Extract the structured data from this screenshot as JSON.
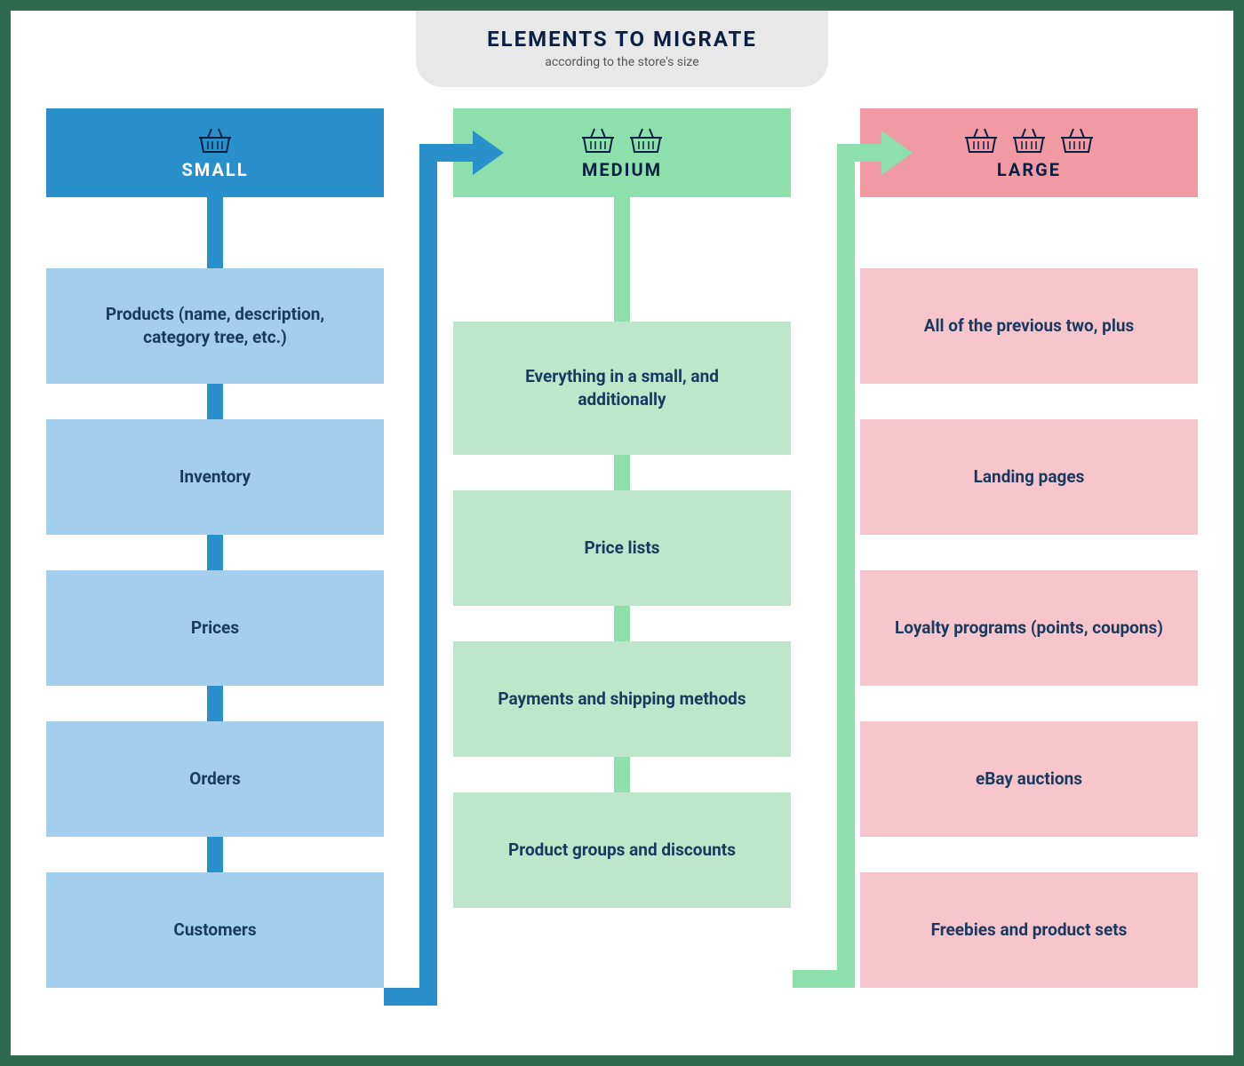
{
  "title": "ELEMENTS TO MIGRATE",
  "subtitle": "according to the store's size",
  "columns": {
    "small": {
      "label": "SMALL",
      "baskets": 1,
      "items": [
        "Products (name, description, category tree, etc.)",
        "Inventory",
        "Prices",
        "Orders",
        "Customers"
      ]
    },
    "medium": {
      "label": "MEDIUM",
      "baskets": 2,
      "items": [
        "Everything in a small, and additionally",
        "Price lists",
        "Payments and shipping methods",
        "Product groups and discounts"
      ]
    },
    "large": {
      "label": "LARGE",
      "baskets": 3,
      "items": [
        "All of the previous two, plus",
        "Landing pages",
        "Loyalty programs (points, coupons)",
        "eBay auctions",
        "Freebies and product sets"
      ]
    }
  },
  "colors": {
    "small_header": "#2990cc",
    "small_item": "#a3cfec",
    "medium_header": "#8ddfab",
    "medium_item": "#bde6ca",
    "large_header": "#f29aa3",
    "large_item": "#f7c6cc",
    "text": "#173a5e"
  }
}
